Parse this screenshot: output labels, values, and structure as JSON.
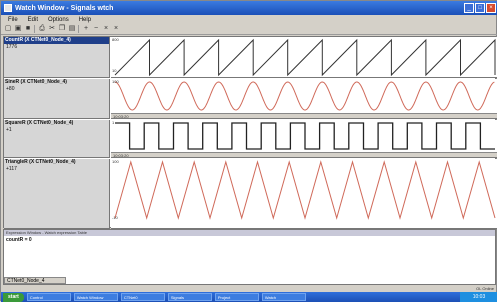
{
  "window": {
    "title": "Watch Window - Signals wtch"
  },
  "menu": [
    "File",
    "Edit",
    "Options",
    "Help"
  ],
  "toolbar": [
    "new",
    "open",
    "save",
    "print",
    "cut",
    "copy",
    "paste",
    "zoom-in",
    "zoom-out",
    "delete",
    "close"
  ],
  "signals": [
    {
      "name": "CountR (X CTNet0_Node_4)",
      "value": "1776",
      "ymax": "800",
      "ymin": "10",
      "time": "10:03:20",
      "wave": "sawtooth",
      "cycles": 11,
      "color": "#333333",
      "header_highlight": true
    },
    {
      "name": "SineR (X CTNet0_Node_4)",
      "value": "+80",
      "ymax": "100",
      "ymin": "-100",
      "time": "10:03:20",
      "wave": "sine",
      "cycles": 11,
      "color": "#d06a5a",
      "header_highlight": false
    },
    {
      "name": "SquareR (X CTNet0_Node_4)",
      "value": "+1",
      "ymax": "1",
      "ymin": "-1",
      "time": "10:03:20",
      "wave": "square",
      "cycles": 13,
      "color": "#222222",
      "header_highlight": false
    },
    {
      "name": "TriangleR (X CTNet0_Node_4)",
      "value": "+117",
      "ymax": "100",
      "ymin": "-10",
      "time": "10:03:20",
      "wave": "triangle",
      "cycles": 12,
      "color": "#d06a5a",
      "header_highlight": false
    }
  ],
  "expressions": {
    "header": "Expression Window - Watch expression Table",
    "line": "countR = 0",
    "tab": "CTNet0_Node_4"
  },
  "status": {
    "right": "OL Online"
  },
  "taskbar": {
    "start": "start",
    "tasks": [
      "Control",
      "Watch Window",
      "CTNet0",
      "Signals",
      "Project",
      "Watch"
    ],
    "tray": "10:03"
  }
}
